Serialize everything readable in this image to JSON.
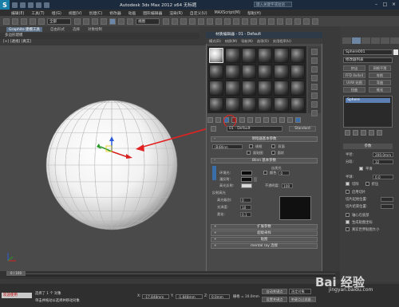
{
  "app": {
    "title": "Autodesk 3ds Max 2012 x64  无标题",
    "search_placeholder": "键入关键字或短语"
  },
  "menu_bar": [
    "编辑(E)",
    "工具(T)",
    "组(G)",
    "视图(V)",
    "创建(C)",
    "修改器",
    "动画",
    "图形编辑器",
    "渲染(R)",
    "自定义(U)",
    "MAXScript(M)",
    "帮助(H)"
  ],
  "toolbar": {
    "selection_filter": "全部",
    "view_dropdown": "视图"
  },
  "ribbon": {
    "tabs": [
      "Graphite 建模工具",
      "自由形式",
      "选择",
      "对象绘制"
    ]
  },
  "viewport": {
    "header": "多边形建模",
    "labels": "[+] [透视] [真实]"
  },
  "material_editor": {
    "title": "材质编辑器 - 01 - Default",
    "menus": [
      "模式(D)",
      "材质(M)",
      "导航(N)",
      "选项(O)",
      "实用程序(U)"
    ],
    "material_name": "01 - Default",
    "material_type": "Standard",
    "rollouts": {
      "shader": "明暗器基本参数",
      "blinn": "Blinn 基本参数",
      "extended": "扩展参数",
      "supersampling": "超级采样",
      "maps": "贴图",
      "mental_ray": "mental ray 连接"
    },
    "shader_type": "(B)Blinn",
    "shader_options": [
      "线框",
      "双面",
      "面贴图",
      "面状"
    ],
    "self_illum_label": "自发光",
    "color_label": "颜色",
    "color_value": "0",
    "ambient_label": "环境光:",
    "diffuse_label": "漫反射:",
    "specular_label": "高光反射:",
    "opacity_label": "不透明度:",
    "opacity_value": "100",
    "spec_highlight_label": "反射高光",
    "spec_level_label": "高光级别:",
    "spec_level_value": "0",
    "glossiness_label": "光泽度:",
    "glossiness_value": "10",
    "soften_label": "柔化:",
    "soften_value": "0.1"
  },
  "command_panel": {
    "object_name": "Sphere001",
    "modifier_list": "修改器列表",
    "buttons": [
      "挤出",
      "网格平滑",
      "FFD 4x4x4",
      "车削",
      "UVW 贴图",
      "弯曲",
      "扭曲",
      "锥化"
    ],
    "stack_item": "Sphere",
    "params_title": "参数",
    "radius_label": "半径:",
    "radius_value": "200.0mm",
    "segments_label": "分段:",
    "segments_value": "32",
    "smooth_label": "平滑",
    "hemisphere_label": "半球:",
    "hemisphere_value": "0.0",
    "chop_label": "切除",
    "squash_label": "挤压",
    "slice_label": "启用切片",
    "slice_from_label": "切片起始位置:",
    "slice_to_label": "切片结束位置:",
    "pivot_label": "轴心在底部",
    "gen_coords_label": "生成贴图坐标",
    "real_world_label": "真实世界贴图大小"
  },
  "timeline": {
    "frame_counter": "0 / 100"
  },
  "status": {
    "maxscript": "欢迎使用",
    "line1": "选择了 1 个 对象",
    "line2": "单击并拖动以选择并移动对象",
    "x_label": "X:",
    "x_value": "-17.848mm",
    "y_label": "Y:",
    "y_value": "-1.848mm",
    "z_label": "Z:",
    "z_value": "0.0mm",
    "grid_label": "栅格 = 10.0mm",
    "auto_key": "自动关键点",
    "selected": "选定对象",
    "set_key": "设置关键点",
    "key_filters": "关键点过滤器..."
  },
  "watermark": {
    "brand": "Bai 经验",
    "url": "jingyan.baidu.com"
  },
  "colors": {
    "title_bar": "#1b2b3d",
    "accent_blue": "#3a6ea8",
    "selection_red": "#e22222"
  }
}
